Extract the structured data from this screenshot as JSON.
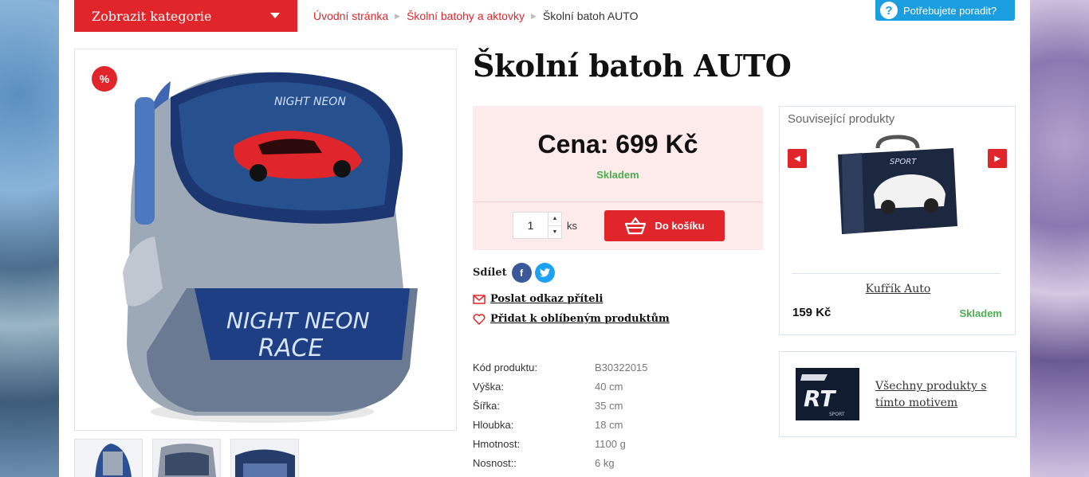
{
  "header": {
    "category_button": "Zobrazit kategorie",
    "help_label": "Potřebujete poradit?",
    "help_icon": "?"
  },
  "breadcrumb": {
    "items": [
      "Úvodní stránka",
      "Školní batohy a aktovky"
    ],
    "current": "Školní batoh AUTO"
  },
  "product": {
    "title": "Školní batoh AUTO",
    "sale_badge": "%",
    "price": "Cena: 699 Kč",
    "stock": "Skladem",
    "quantity": "1",
    "unit": "ks",
    "cart_button": "Do košíku",
    "share_label": "Sdílet",
    "facebook": "f",
    "send_link": "Poslat odkaz příteli",
    "add_favorite": "Přidat k oblíbeným produktům",
    "params": [
      {
        "key": "Kód produktu:",
        "value": "B30322015"
      },
      {
        "key": "Výška:",
        "value": "40 cm"
      },
      {
        "key": "Šířka:",
        "value": "35 cm"
      },
      {
        "key": "Hloubka:",
        "value": "18 cm"
      },
      {
        "key": "Hmotnost:",
        "value": "1100 g"
      },
      {
        "key": "Nosnost::",
        "value": "6 kg"
      }
    ],
    "thumbnails": 3
  },
  "related": {
    "title": "Související produkty",
    "name": "Kufřík Auto",
    "price": "159 Kč",
    "stock": "Skladem"
  },
  "motive": {
    "link": "Všechny produkty s tímto motivem"
  },
  "colors": {
    "accent": "#e0262b",
    "in_stock": "#4caf50",
    "help": "#1a9ee0"
  }
}
